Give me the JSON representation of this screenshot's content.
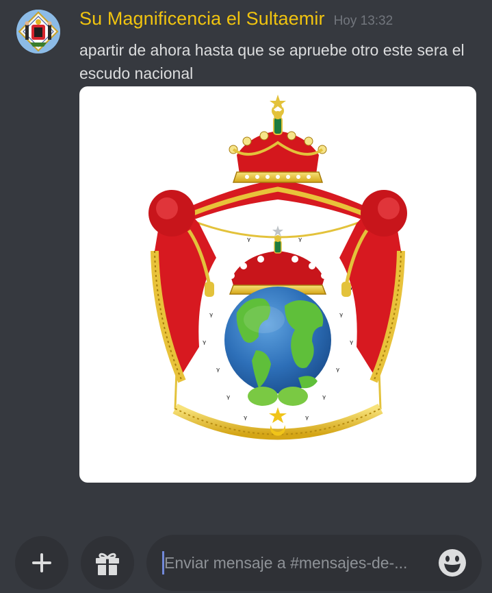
{
  "message": {
    "author": "Su Magnificencia el Sultaemir",
    "timestamp": "Hoy 13:32",
    "content": "apartir de ahora hasta que se apruebe otro este sera el escudo nacional",
    "author_color": "#f1c40f"
  },
  "composer": {
    "placeholder": "Enviar mensaje a #mensajes-de-...",
    "add_icon": "plus-icon",
    "gift_icon": "gift-icon",
    "emoji_icon": "smiley-emoji-icon"
  },
  "colors": {
    "background": "#36393f",
    "input_background": "#2f3136",
    "caret": "#7289da"
  }
}
